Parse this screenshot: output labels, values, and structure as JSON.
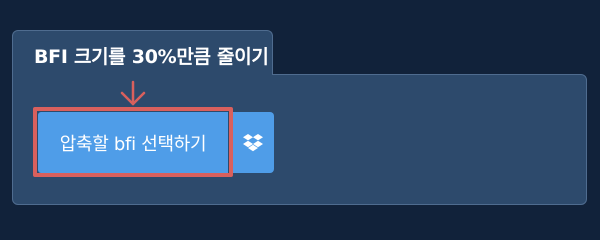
{
  "panel": {
    "title": "BFI 크기를 30%만큼 줄이기"
  },
  "upload": {
    "select_label": "압축할 bfi 선택하기",
    "dropbox_icon": "dropbox-icon"
  },
  "annotation": {
    "arrow_icon": "arrow-down-icon"
  },
  "colors": {
    "background": "#11223a",
    "panel": "#2d4a6c",
    "button": "#4f9de8",
    "highlight": "#d9605d"
  }
}
